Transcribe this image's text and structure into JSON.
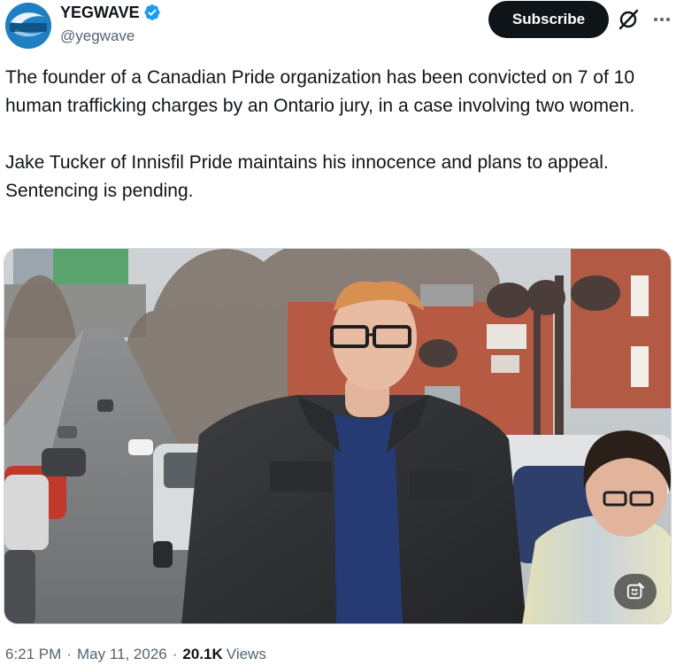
{
  "author": {
    "display_name": "YEGWAVE",
    "handle": "@yegwave",
    "avatar_text": "YEGWAVE",
    "verified_icon": "verified-badge-icon",
    "colors": {
      "verified": "#1d9bf0",
      "avatar": "#1f7fc2"
    }
  },
  "header": {
    "subscribe_label": "Subscribe",
    "grok_icon": "grok-icon",
    "more_icon": "more-options-icon"
  },
  "tweet": {
    "paragraphs": [
      "The founder of a Canadian Pride organization has been convicted on 7 of 10 human trafficking charges by an Ontario jury, in a case involving two women.",
      "Jake Tucker of Innisfil Pride maintains his innocence and plans to appeal. Sentencing is pending."
    ]
  },
  "media": {
    "type": "photo",
    "alt_button_icon": "image-description-icon"
  },
  "meta": {
    "time": "6:21 PM",
    "date": "May 11, 2026",
    "views_count": "20.1K",
    "views_label": "Views"
  },
  "colors": {
    "text_primary": "#0f1419",
    "text_secondary": "#536471",
    "button_bg": "#0f1419"
  }
}
